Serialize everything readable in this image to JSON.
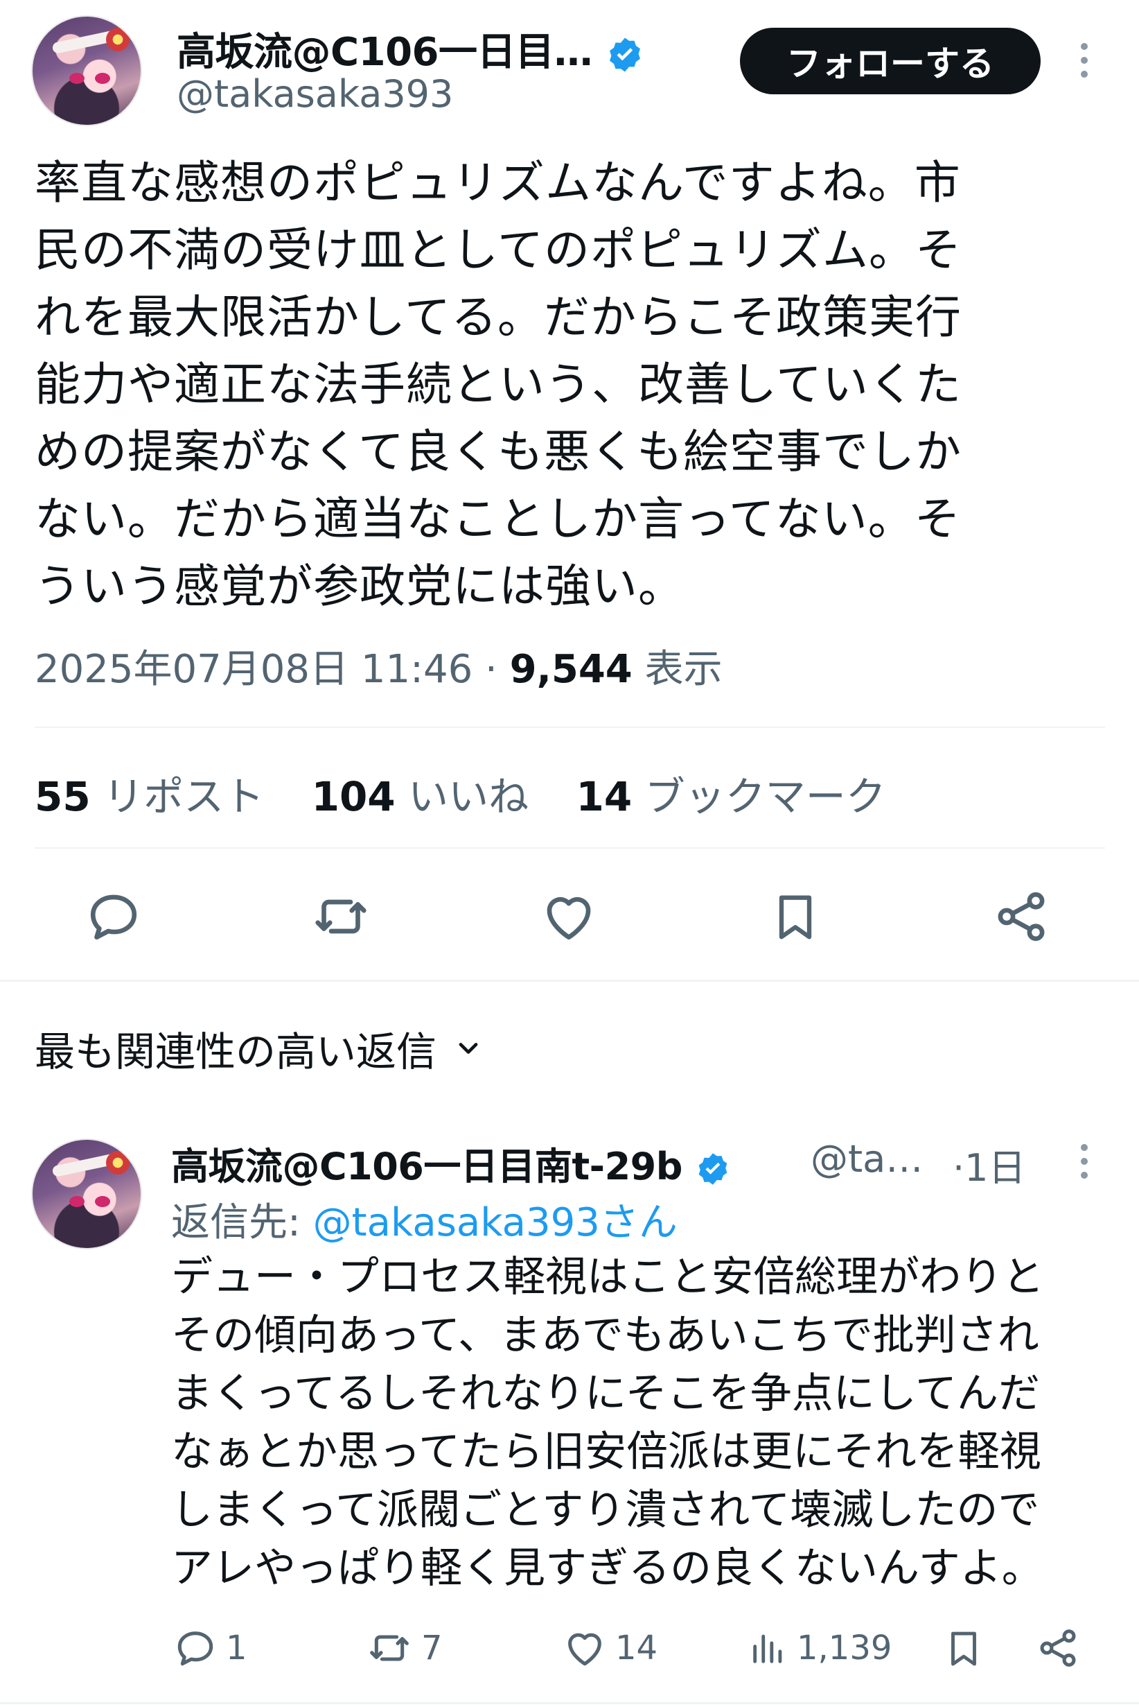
{
  "tweet": {
    "author": {
      "display_name": "高坂流@C106一日目…",
      "handle": "@takasaka393",
      "verified": true
    },
    "follow_label": "フォローする",
    "text_lines": [
      "率直な感想のポピュリズムなんですよね。市",
      "民の不満の受け皿としてのポピュリズム。そ",
      "れを最大限活かしてる。だからこそ政策実行",
      "能力や適正な法手続という、改善していくた",
      "めの提案がなくて良くも悪くも絵空事でしか",
      "ない。だから適当なことしか言ってない。そ",
      "ういう感覚が参政党には強い。"
    ],
    "timestamp": "2025年07月08日 11:46",
    "separator": " · ",
    "views_count": "9,544",
    "views_label": " 表示",
    "stats": {
      "reposts_count": "55",
      "reposts_label": " リポスト",
      "likes_count": "104",
      "likes_label": " いいね",
      "bookmarks_count": "14",
      "bookmarks_label": " ブックマーク"
    }
  },
  "replies_sort_label": "最も関連性の高い返信",
  "reply": {
    "author": {
      "display_name": "高坂流@C106一日目南t-29b",
      "handle_truncated": "@ta…",
      "time": "·1日",
      "verified": true
    },
    "reply_to_prefix": "返信先: ",
    "reply_to_handle": "@takasaka393さん",
    "text_lines": [
      "デュー・プロセス軽視はこと安倍総理がわりと",
      "その傾向あって、まあでもあいこちで批判され",
      "まくってるしそれなりにそこを争点にしてんだ",
      "なぁとか思ってたら旧安倍派は更にそれを軽視",
      "しまくって派閥ごとすり潰されて壊滅したので",
      "アレやっぱり軽く見すぎるの良くないんすよ。"
    ],
    "actions": {
      "replies": "1",
      "reposts": "7",
      "likes": "14",
      "views": "1,139"
    }
  },
  "colors": {
    "text": "#0f1419",
    "secondary": "#536471",
    "link": "#1d9bf0",
    "verified": "#1d9bf0",
    "divider": "#eff3f4"
  }
}
